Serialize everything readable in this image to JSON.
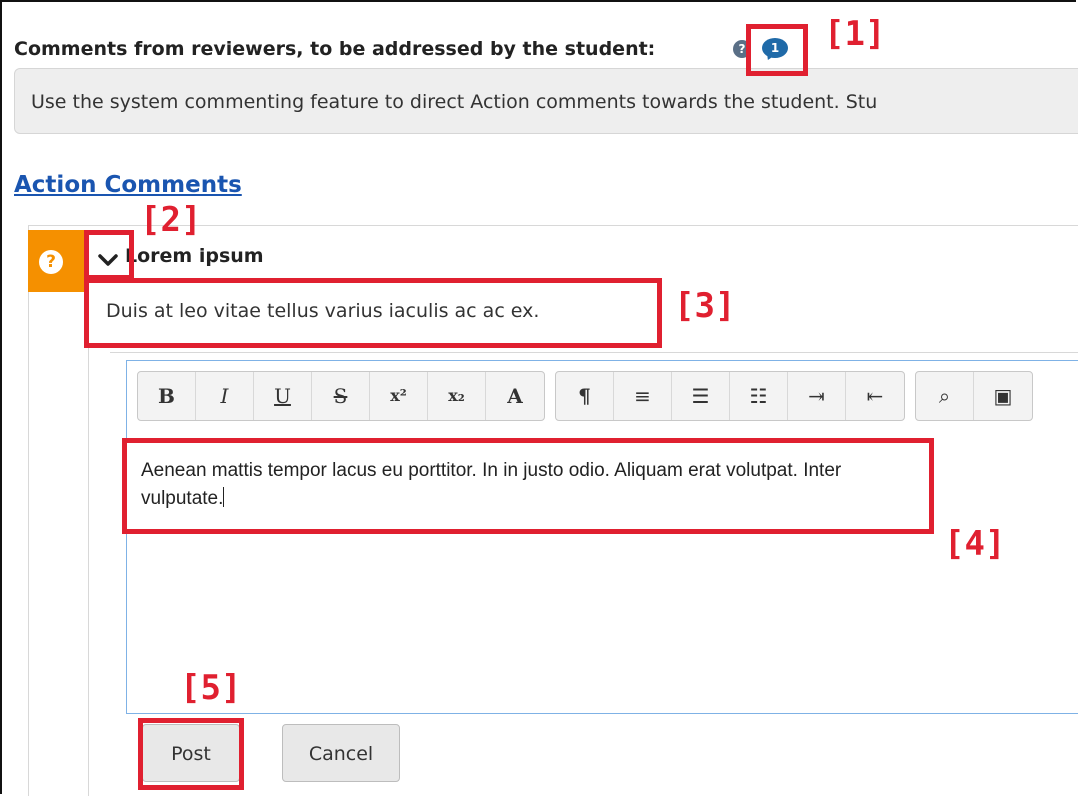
{
  "header": {
    "title": "Comments from reviewers, to be addressed by the student:",
    "help_icon": "question-circle-icon",
    "comment_count": "1"
  },
  "info_bar": {
    "text": "Use the system commenting feature to direct Action comments towards the student.  Stu"
  },
  "section": {
    "title": "Action Comments"
  },
  "comment": {
    "status_icon": "question-icon",
    "title": "Lorem ipsum",
    "body": "Duis at leo vitae tellus varius iaculis ac ac ex."
  },
  "toolbar": {
    "bold": "B",
    "italic": "I",
    "underline": "U",
    "strikethrough": "S",
    "superscript": "x²",
    "subscript": "x₂",
    "font": "A",
    "paragraph": "¶",
    "align": "≡",
    "bullets": "☰",
    "numbered": "☷",
    "indent": "⇥",
    "outdent": "⇤",
    "find": "⌕",
    "image": "▣"
  },
  "editor": {
    "text_line1": "Aenean mattis tempor lacus eu porttitor. In in justo odio. Aliquam erat volutpat. Inter",
    "text_line2": "vulputate."
  },
  "actions": {
    "post_label": "Post",
    "cancel_label": "Cancel"
  },
  "annotations": {
    "a1": "[1]",
    "a2": "[2]",
    "a3": "[3]",
    "a4": "[4]",
    "a5": "[5]",
    "color": "#e02030"
  },
  "colors": {
    "accent_orange": "#f59000",
    "link_blue": "#1a55b0",
    "bubble_blue": "#1f6aa8"
  }
}
